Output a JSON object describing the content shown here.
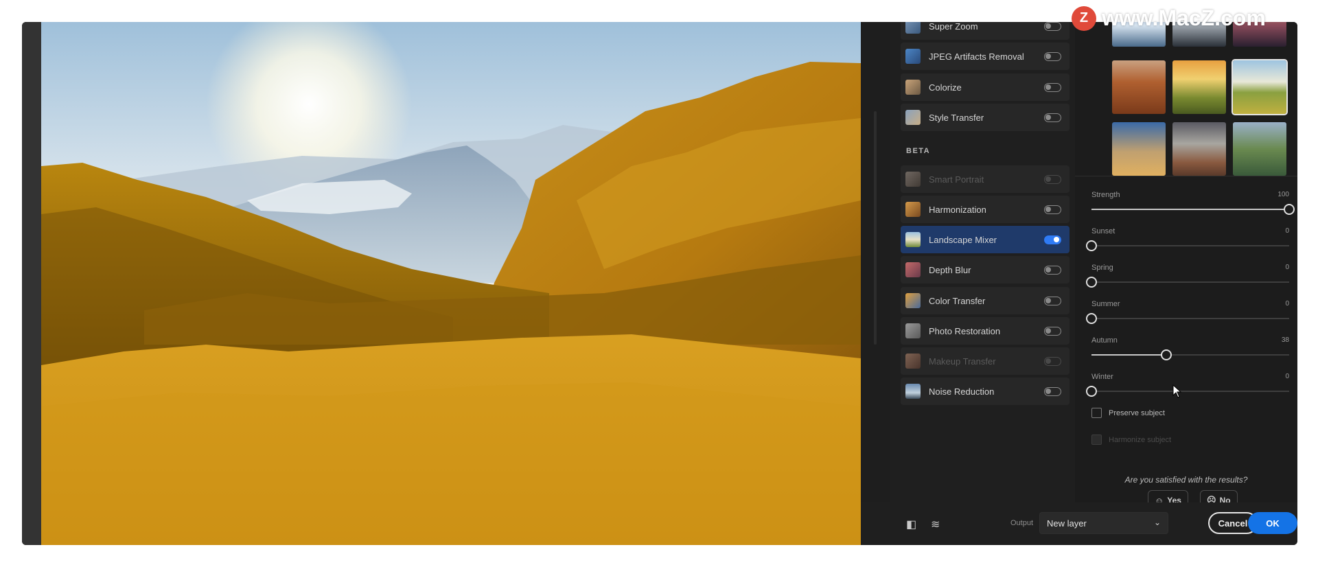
{
  "filters": {
    "items": [
      {
        "label": "Super Zoom",
        "on": false,
        "disabled": false,
        "icon": "super-zoom"
      },
      {
        "label": "JPEG Artifacts Removal",
        "on": false,
        "disabled": false,
        "icon": "jpeg-artifacts"
      },
      {
        "label": "Colorize",
        "on": false,
        "disabled": false,
        "icon": "colorize"
      },
      {
        "label": "Style Transfer",
        "on": false,
        "disabled": false,
        "icon": "style-transfer"
      }
    ],
    "beta_label": "BETA",
    "beta_items": [
      {
        "label": "Smart Portrait",
        "on": false,
        "disabled": true,
        "icon": "smart-portrait"
      },
      {
        "label": "Harmonization",
        "on": false,
        "disabled": false,
        "icon": "harmonization"
      },
      {
        "label": "Landscape Mixer",
        "on": true,
        "disabled": false,
        "icon": "landscape-mixer"
      },
      {
        "label": "Depth Blur",
        "on": false,
        "disabled": false,
        "icon": "depth-blur"
      },
      {
        "label": "Color Transfer",
        "on": false,
        "disabled": false,
        "icon": "color-transfer"
      },
      {
        "label": "Photo Restoration",
        "on": false,
        "disabled": false,
        "icon": "photo-restoration"
      },
      {
        "label": "Makeup Transfer",
        "on": false,
        "disabled": true,
        "icon": "makeup-transfer"
      },
      {
        "label": "Noise Reduction",
        "on": false,
        "disabled": false,
        "icon": "noise-reduction"
      }
    ]
  },
  "settings": {
    "sliders": [
      {
        "label": "Strength",
        "value": "100",
        "fraction": 1.0
      },
      {
        "label": "Sunset",
        "value": "0",
        "fraction": 0.0
      },
      {
        "label": "Spring",
        "value": "0",
        "fraction": 0.0
      },
      {
        "label": "Summer",
        "value": "0",
        "fraction": 0.0
      },
      {
        "label": "Autumn",
        "value": "38",
        "fraction": 0.38
      },
      {
        "label": "Winter",
        "value": "0",
        "fraction": 0.0
      }
    ],
    "preserve_subject": "Preserve subject",
    "harmonize_subject": "Harmonize subject",
    "feedback_question": "Are you satisfied with the results?",
    "yes_label": "Yes",
    "no_label": "No"
  },
  "bottom": {
    "output_label": "Output",
    "output_value": "New layer",
    "cancel_label": "Cancel",
    "ok_label": "OK"
  },
  "watermark": {
    "logo_letter": "Z",
    "text": "www.MacZ.com"
  },
  "colors": {
    "accent": "#1473e6",
    "active_item": "#1f3a6a",
    "panel": "#1f1f1f"
  }
}
